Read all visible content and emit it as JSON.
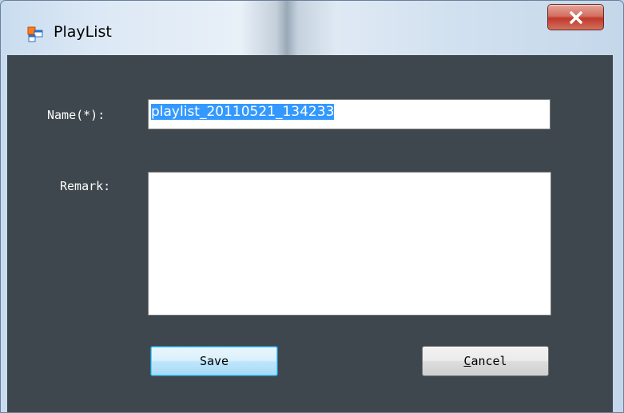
{
  "window": {
    "title": "PlayList",
    "icon": "app-window-icon",
    "close_icon": "close-icon"
  },
  "form": {
    "name_label": "Name(*):",
    "name_value": "playlist_20110521_134233",
    "remark_label": "Remark:",
    "remark_value": ""
  },
  "buttons": {
    "save_label": "Save",
    "cancel_mnemonic": "C",
    "cancel_rest": "ancel"
  },
  "colors": {
    "client_bg": "#3e474d",
    "selection": "#3399ff",
    "close_button": "#c0392b",
    "default_button_border": "#3c7fb1"
  }
}
